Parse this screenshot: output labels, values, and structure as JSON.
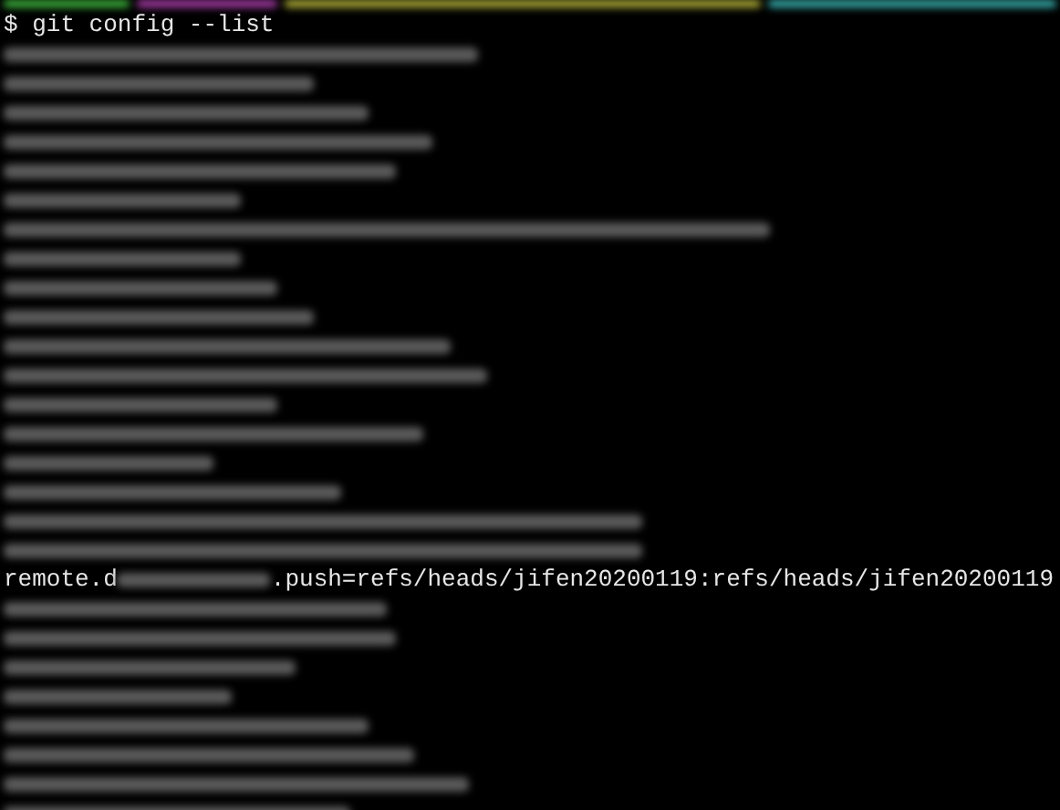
{
  "terminal": {
    "command": "$ git config --list",
    "output_line": {
      "prefix": "remote.d",
      "suffix": ".push=refs/heads/jifen20200119:refs/heads/jifen20200119"
    }
  }
}
